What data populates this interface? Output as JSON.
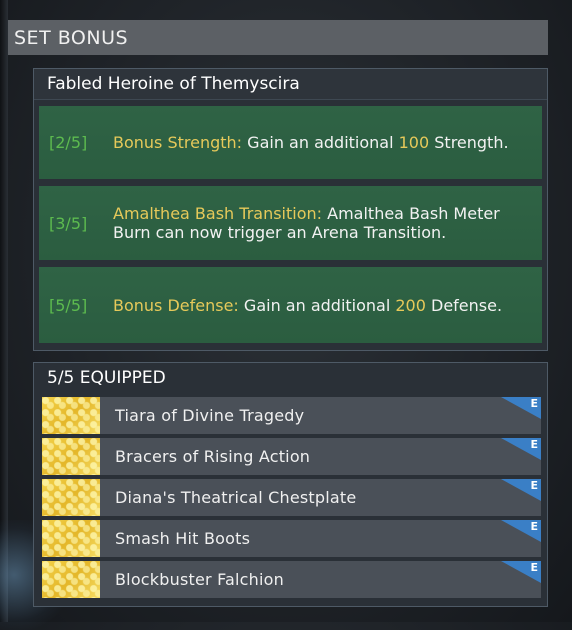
{
  "header": {
    "title": "SET BONUS"
  },
  "set": {
    "name": "Fabled Heroine of Themyscira",
    "bonuses": [
      {
        "tier": "[2/5]",
        "name": "Bonus Strength:",
        "text_pre": "Gain an additional ",
        "value": "100",
        "text_post": " Strength."
      },
      {
        "tier": "[3/5]",
        "name": "Amalthea Bash Transition:",
        "text": "Amalthea Bash Meter Burn can now trigger an Arena Transition."
      },
      {
        "tier": "[5/5]",
        "name": "Bonus Defense:",
        "text_pre": "Gain an additional ",
        "value": "200",
        "text_post": " Defense."
      }
    ]
  },
  "equipped": {
    "title": "5/5 EQUIPPED",
    "items": [
      {
        "name": "Tiara of Divine Tragedy",
        "badge": "E"
      },
      {
        "name": "Bracers of Rising Action",
        "badge": "E"
      },
      {
        "name": "Diana's Theatrical Chestplate",
        "badge": "E"
      },
      {
        "name": "Smash Hit Boots",
        "badge": "E"
      },
      {
        "name": "Blockbuster Falchion",
        "badge": "E"
      }
    ]
  },
  "colors": {
    "bonus_green": "#2d6043",
    "tier_green": "#5dbb4f",
    "highlight_gold": "#e6c95a",
    "badge_blue": "#3a7fc6",
    "item_gold": "#e9c23a"
  }
}
